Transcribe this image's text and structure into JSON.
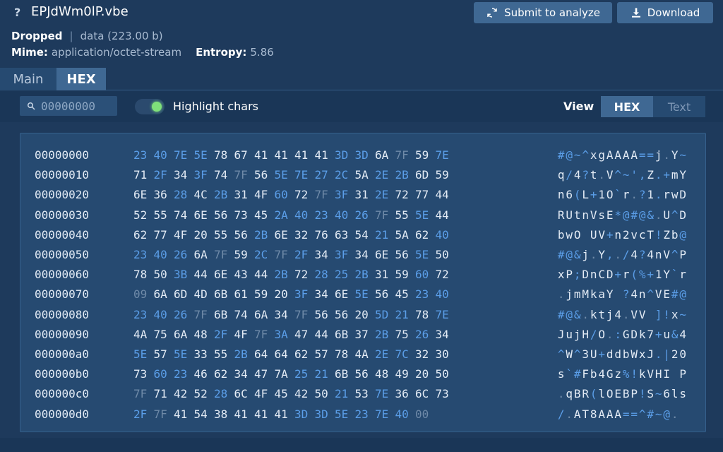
{
  "header": {
    "help_glyph": "?",
    "title": "EPJdWm0lP.vbe",
    "submit_label": "Submit to analyze",
    "download_label": "Download",
    "status": "Dropped",
    "type_info": "data (223.00 b)",
    "mime_label": "Mime:",
    "mime_value": "application/octet-stream",
    "entropy_label": "Entropy:",
    "entropy_value": "5.86"
  },
  "tabs": [
    {
      "label": "Main",
      "active": false
    },
    {
      "label": "HEX",
      "active": true
    }
  ],
  "toolbar": {
    "offset_placeholder": "00000000",
    "highlight_label": "Highlight chars",
    "highlight_on": true,
    "view_label": "View",
    "view_options": [
      "HEX",
      "Text"
    ],
    "view_selected": "HEX"
  },
  "colors": {
    "printable_symbol": "#5b9ee8",
    "normal": "#e3ebf5",
    "dim": "#6f8aa8",
    "accent_button": "#3f6893",
    "toggle_on": "#7fe07a"
  },
  "hex_rows": [
    {
      "offset": "00000000",
      "bytes": "23 40 7E 5E 78 67 41 41 41 41 3D 3D 6A 7F 59 7E"
    },
    {
      "offset": "00000010",
      "bytes": "71 2F 34 3F 74 7F 56 5E 7E 27 2C 5A 2E 2B 6D 59"
    },
    {
      "offset": "00000020",
      "bytes": "6E 36 28 4C 2B 31 4F 60 72 7F 3F 31 2E 72 77 44"
    },
    {
      "offset": "00000030",
      "bytes": "52 55 74 6E 56 73 45 2A 40 23 40 26 7F 55 5E 44"
    },
    {
      "offset": "00000040",
      "bytes": "62 77 4F 20 55 56 2B 6E 32 76 63 54 21 5A 62 40"
    },
    {
      "offset": "00000050",
      "bytes": "23 40 26 6A 7F 59 2C 7F 2F 34 3F 34 6E 56 5E 50"
    },
    {
      "offset": "00000060",
      "bytes": "78 50 3B 44 6E 43 44 2B 72 28 25 2B 31 59 60 72"
    },
    {
      "offset": "00000070",
      "bytes": "09 6A 6D 4D 6B 61 59 20 3F 34 6E 5E 56 45 23 40"
    },
    {
      "offset": "00000080",
      "bytes": "23 40 26 7F 6B 74 6A 34 7F 56 56 20 5D 21 78 7E"
    },
    {
      "offset": "00000090",
      "bytes": "4A 75 6A 48 2F 4F 7F 3A 47 44 6B 37 2B 75 26 34"
    },
    {
      "offset": "000000a0",
      "bytes": "5E 57 5E 33 55 2B 64 64 62 57 78 4A 2E 7C 32 30"
    },
    {
      "offset": "000000b0",
      "bytes": "73 60 23 46 62 34 47 7A 25 21 6B 56 48 49 20 50"
    },
    {
      "offset": "000000c0",
      "bytes": "7F 71 42 52 28 6C 4F 45 42 50 21 53 7E 36 6C 73"
    },
    {
      "offset": "000000d0",
      "bytes": "2F 7F 41 54 38 41 41 41 3D 3D 5E 23 7E 40 00"
    }
  ]
}
